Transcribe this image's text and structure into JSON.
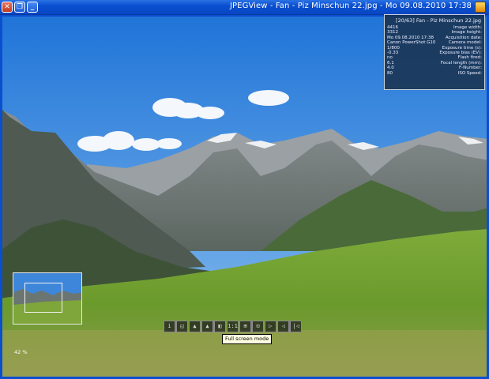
{
  "window": {
    "title": "JPEGView - Fan - Piz Minschun 22.jpg - Mo 09.08.2010 17:38",
    "buttons": {
      "close": "✕",
      "maximize": "❐",
      "minimize": "_"
    }
  },
  "info_panel": {
    "header": "[20/63] Fan - Piz Minschun 22.jpg",
    "fields": [
      {
        "label": "Image width:",
        "value": "4416"
      },
      {
        "label": "Image height:",
        "value": "3312"
      },
      {
        "label": "Acquisition date:",
        "value": "Mo 09.08.2010 17:38"
      },
      {
        "label": "Camera model:",
        "value": "Canon PowerShot G10"
      },
      {
        "label": "Exposure time (s):",
        "value": "1/800"
      },
      {
        "label": "Exposure bias (EV):",
        "value": "-0.33"
      },
      {
        "label": "Flash fired:",
        "value": "no"
      },
      {
        "label": "Focal length (mm):",
        "value": "6.1"
      },
      {
        "label": "F-Number:",
        "value": "4.0"
      },
      {
        "label": "ISO Speed:",
        "value": "80"
      }
    ]
  },
  "toolbar": {
    "buttons": [
      "i",
      "◱",
      "▲",
      "▲",
      "◧",
      "1:1",
      "⊞",
      "⊡",
      "▷",
      "◁",
      "|◁"
    ],
    "tooltip": "Full screen mode"
  },
  "zoom_text": "42 %",
  "colors": {
    "titlebar": "#0a4fd0",
    "sky_top": "#2d7fdc",
    "sky_bottom": "#7fb7ec",
    "grass": "#6a9a2a"
  }
}
